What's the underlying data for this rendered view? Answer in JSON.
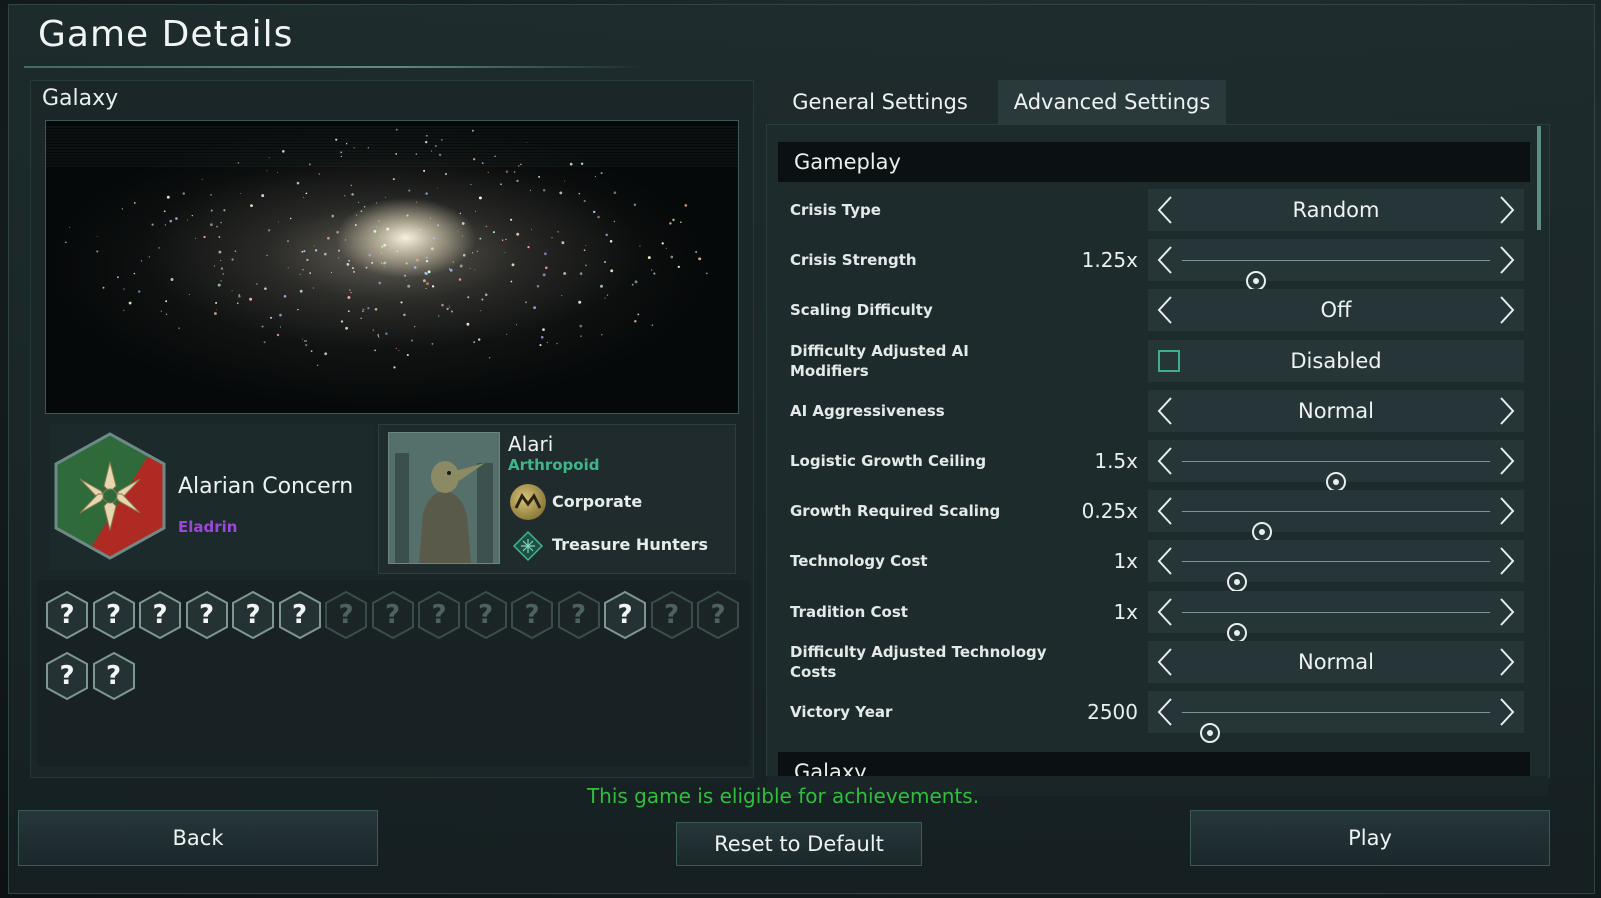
{
  "title": "Game Details",
  "galaxy": {
    "label": "Galaxy"
  },
  "empire": {
    "name": "Alarian Concern",
    "government": "Eladrin"
  },
  "species": {
    "name": "Alari",
    "class": "Arthropoid",
    "ethic": "Corporate",
    "trait": "Treasure Hunters"
  },
  "hex_slots": {
    "row1": [
      "?",
      "?",
      "?",
      "?",
      "?",
      "?",
      "?",
      "?",
      "?",
      "?",
      "?",
      "?",
      "?",
      "?",
      "?"
    ],
    "row1_active": [
      true,
      true,
      true,
      true,
      true,
      true,
      false,
      false,
      false,
      false,
      false,
      false,
      true,
      false,
      false
    ],
    "row2": [
      "?",
      "?"
    ]
  },
  "tabs": [
    "General Settings",
    "Advanced Settings"
  ],
  "sections": {
    "gameplay": "Gameplay",
    "galaxy": "Galaxy"
  },
  "settings": [
    {
      "label": "Crisis Type",
      "type": "select",
      "value": "Random"
    },
    {
      "label": "Crisis Strength",
      "type": "slider",
      "display": "1.25x",
      "fraction": 0.24
    },
    {
      "label": "Scaling Difficulty",
      "type": "select",
      "value": "Off"
    },
    {
      "label": "Difficulty Adjusted AI Modifiers",
      "type": "checkbox",
      "value": "Disabled",
      "checked": false
    },
    {
      "label": "AI Aggressiveness",
      "type": "select",
      "value": "Normal"
    },
    {
      "label": "Logistic Growth Ceiling",
      "type": "slider",
      "display": "1.5x",
      "fraction": 0.5
    },
    {
      "label": "Growth Required Scaling",
      "type": "slider",
      "display": "0.25x",
      "fraction": 0.26
    },
    {
      "label": "Technology Cost",
      "type": "slider",
      "display": "1x",
      "fraction": 0.18
    },
    {
      "label": "Tradition Cost",
      "type": "slider",
      "display": "1x",
      "fraction": 0.18
    },
    {
      "label": "Difficulty Adjusted Technology Costs",
      "type": "select",
      "value": "Normal"
    },
    {
      "label": "Victory Year",
      "type": "slider",
      "display": "2500",
      "fraction": 0.09
    }
  ],
  "achievement_text": "This game is eligible for achievements.",
  "buttons": {
    "back": "Back",
    "reset": "Reset to Default",
    "play": "Play"
  },
  "colors": {
    "accent_green": "#2fbf3c",
    "species_class": "#3fb68a",
    "government": "#9b48d8"
  }
}
